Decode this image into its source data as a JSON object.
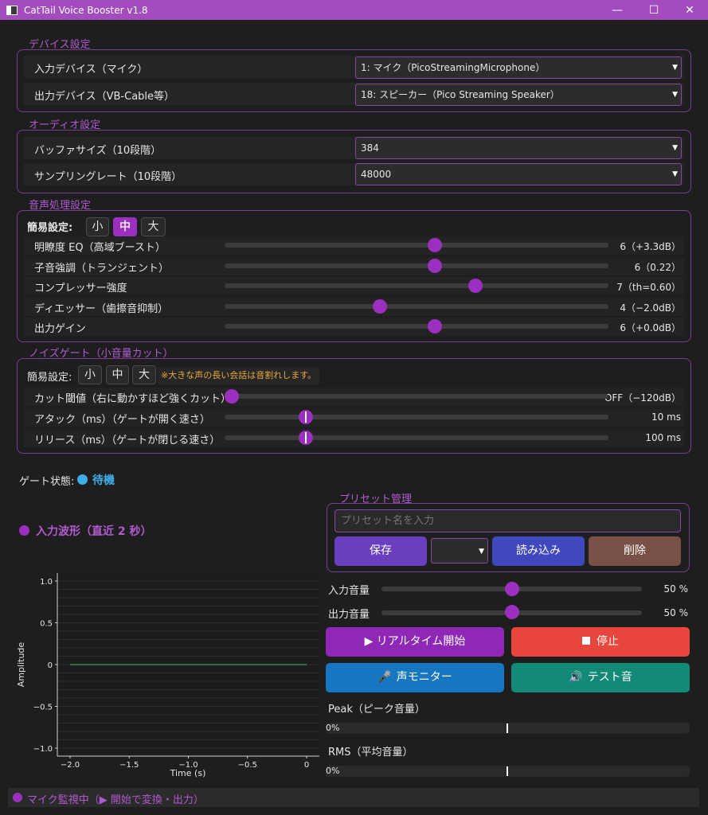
{
  "window": {
    "title": "CatTail Voice Booster v1.8",
    "minimize": "—",
    "maximize": "☐",
    "close": "✕"
  },
  "device": {
    "title": "デバイス設定",
    "input_label": "入力デバイス（マイク）",
    "input_value": "1: マイク（PicoStreamingMicrophone）",
    "output_label": "出力デバイス（VB-Cable等）",
    "output_value": "18: スピーカー（Pico Streaming Speaker）"
  },
  "audio": {
    "title": "オーディオ設定",
    "buffer_label": "バッファサイズ（10段階）",
    "buffer_value": "384",
    "rate_label": "サンプリングレート（10段階）",
    "rate_value": "48000"
  },
  "voice": {
    "title": "音声処理設定",
    "preset_label": "簡易設定:",
    "presets": [
      "小",
      "中",
      "大"
    ],
    "active_preset": 1,
    "sliders": [
      {
        "label": "明瞭度 EQ（高域ブースト）",
        "value": "6（+3.3dB）",
        "level": 0.55
      },
      {
        "label": "子音強調（トランジェント）",
        "value": "6（0.22）",
        "level": 0.55
      },
      {
        "label": "コンプレッサー強度",
        "value": "7（th=0.60）",
        "level": 0.66
      },
      {
        "label": "ディエッサー（歯擦音抑制）",
        "value": "4（−2.0dB）",
        "level": 0.4
      },
      {
        "label": "出力ゲイン",
        "value": "6（+0.0dB）",
        "level": 0.55
      }
    ]
  },
  "gate": {
    "title": "ノイズゲート（小音量カット）",
    "preset_label": "簡易設定:",
    "presets": [
      "小",
      "中",
      "大"
    ],
    "warning": "※大きな声の長い会話は音割れします。",
    "sliders": [
      {
        "label": "カット閾値（右に動かすほど強くカット）",
        "value": "OFF（−120dB）",
        "level": 0.0
      },
      {
        "label": "アタック（ms）（ゲートが開く速さ）",
        "value": "10 ms",
        "level": 0.2
      },
      {
        "label": "リリース（ms）（ゲートが閉じる速さ）",
        "value": "100 ms",
        "level": 0.2
      }
    ],
    "status_label": "ゲート状態:",
    "status_value": "待機"
  },
  "waveform": {
    "title": "入力波形（直近 2 秒）"
  },
  "chart_data": {
    "type": "line",
    "title": "",
    "xlabel": "Time (s)",
    "ylabel": "Amplitude",
    "xlim": [
      -2.0,
      0.0
    ],
    "ylim": [
      -1.0,
      1.0
    ],
    "xticks": [
      -2.0,
      -1.5,
      -1.0,
      -0.5,
      0
    ],
    "xtick_labels": [
      "−2.0",
      "−1.5",
      "−1.0",
      "−0.5",
      "0"
    ],
    "yticks": [
      1.0,
      0.5,
      0,
      -0.5,
      -1.0
    ],
    "ytick_labels": [
      "1.0",
      "0.5",
      "0",
      "−0.5",
      "−1.0"
    ],
    "grid": true,
    "series": [
      {
        "x": [
          -2.0,
          -1.5,
          -1.0,
          -0.5,
          0.0
        ],
        "values": [
          0,
          0,
          0,
          0,
          0
        ],
        "color": "#3fbf5f"
      }
    ]
  },
  "preset": {
    "title": "プリセット管理",
    "name_placeholder": "プリセット名を入力",
    "save": "保存",
    "load": "読み込み",
    "delete": "削除"
  },
  "volume": {
    "input_label": "入力音量",
    "input_value": "50 %",
    "input_level": 0.5,
    "output_label": "出力音量",
    "output_value": "50 %",
    "output_level": 0.5
  },
  "controls": {
    "start": "▶ リアルタイム開始",
    "stop": "停止",
    "monitor": "声モニター",
    "test": "テスト音"
  },
  "meters": {
    "peak_label": "Peak（ピーク音量）",
    "peak_value": "0%",
    "rms_label": "RMS（平均音量）",
    "rms_value": "0%"
  },
  "status_bar": {
    "text": "マイク監視中（▶ 開始で変換・出力）"
  },
  "colors": {
    "accent": "#9b2fc0",
    "title_bar": "#a24cbd",
    "start": "#8e28b5",
    "stop": "#e8453c",
    "monitor": "#1677c0",
    "test": "#138a78",
    "save": "#6a3fbf",
    "load": "#3f48bf",
    "delete": "#7a5146",
    "status_dot": "#3eaee8"
  }
}
